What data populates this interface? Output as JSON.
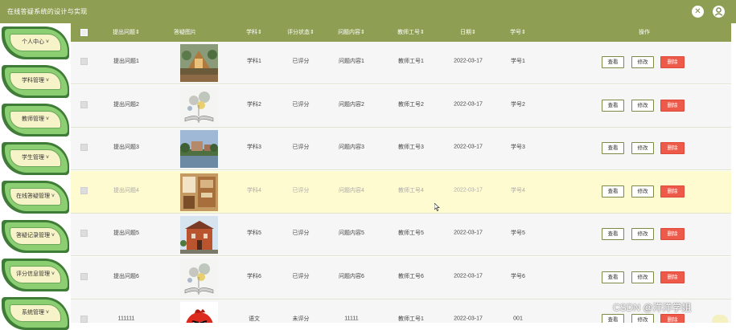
{
  "header": {
    "title": "在线答疑系统的设计与实现",
    "close_icon_glyph": "✕",
    "user_icon_glyph": "👤"
  },
  "sidebar": {
    "items": [
      {
        "label": "个人中心 ˅"
      },
      {
        "label": "学科管理 ˅"
      },
      {
        "label": "教师管理 ˅"
      },
      {
        "label": "学生管理 ˅"
      },
      {
        "label": "在线答疑管理 ˅"
      },
      {
        "label": "答疑记录管理 ˅"
      },
      {
        "label": "评分信息管理 ˅"
      },
      {
        "label": "系统管理 ˅"
      }
    ]
  },
  "table": {
    "columns": [
      "提出问题⇕",
      "答疑图片",
      "学科⇕",
      "评分状态⇕",
      "问题内容⇕",
      "教师工号⇕",
      "日期⇕",
      "学号⇕",
      "操作"
    ],
    "rows": [
      {
        "question": "提出问题1",
        "subject": "学科1",
        "status": "已评分",
        "content": "问题内容1",
        "teacher": "教师工号1",
        "date": "2022-03-17",
        "student": "学号1",
        "image": "temple-photo"
      },
      {
        "question": "提出问题2",
        "subject": "学科2",
        "status": "已评分",
        "content": "问题内容2",
        "teacher": "教师工号2",
        "date": "2022-03-17",
        "student": "学号2",
        "image": "book-sketch"
      },
      {
        "question": "提出问题3",
        "subject": "学科3",
        "status": "已评分",
        "content": "问题内容3",
        "teacher": "教师工号3",
        "date": "2022-03-17",
        "student": "学号3",
        "image": "campus-lake-photo"
      },
      {
        "question": "提出问题4",
        "subject": "学科4",
        "status": "已评分",
        "content": "问题内容4",
        "teacher": "教师工号4",
        "date": "2022-03-17",
        "student": "学号4",
        "image": "dorm-room-photo"
      },
      {
        "question": "提出问题5",
        "subject": "学科5",
        "status": "已评分",
        "content": "问题内容5",
        "teacher": "教师工号5",
        "date": "2022-03-17",
        "student": "学号5",
        "image": "brick-building-photo"
      },
      {
        "question": "提出问题6",
        "subject": "学科6",
        "status": "已评分",
        "content": "问题内容6",
        "teacher": "教师工号6",
        "date": "2022-03-17",
        "student": "学号6",
        "image": "book-sketch"
      },
      {
        "question": "111111",
        "subject": "语文",
        "status": "未评分",
        "content": "11111",
        "teacher": "教师工号1",
        "date": "2022-03-17",
        "student": "001",
        "image": "angry-bird"
      }
    ],
    "actions": {
      "view": "查看",
      "edit": "修改",
      "delete": "删除"
    },
    "highlight_row_index": 3
  },
  "watermark": "CSDN @洋洋学姐",
  "colors": {
    "accent": "#8e9f54",
    "delete": "#ee5a4a",
    "highlight": "#fffbd0",
    "leaf_dark": "#3f7c38",
    "leaf_light": "#8ccf72"
  }
}
